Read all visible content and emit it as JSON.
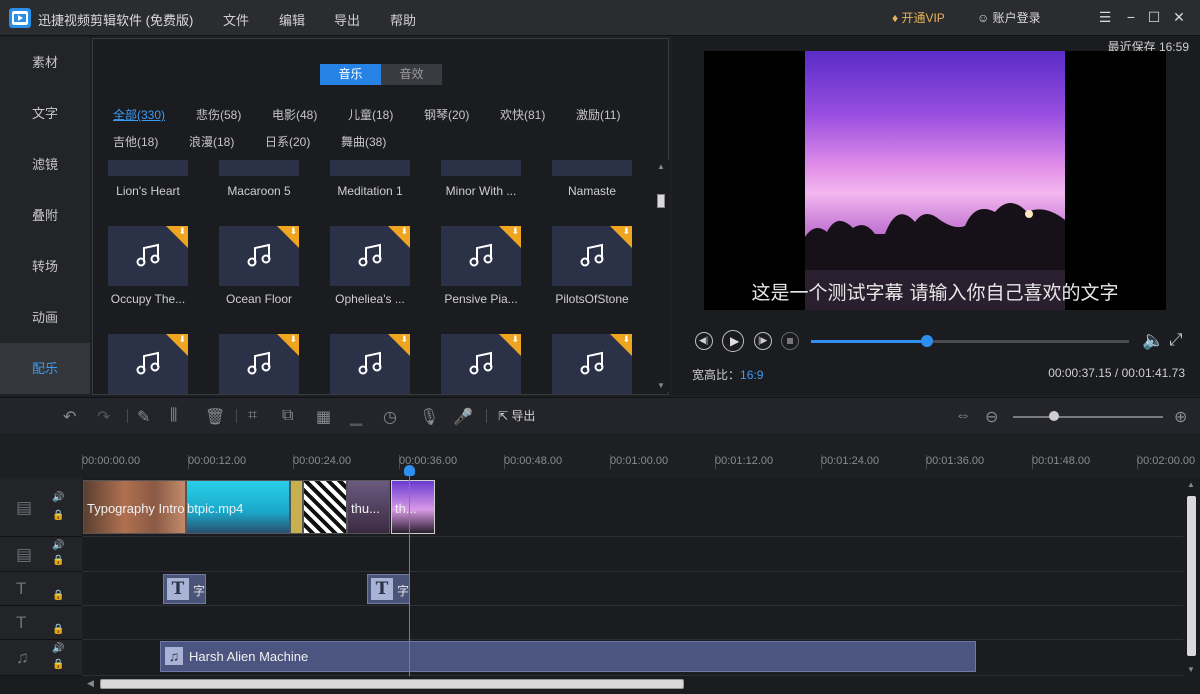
{
  "app": {
    "title": "迅捷视频剪辑软件 (免费版)",
    "accent": "#2e8ff0"
  },
  "menu": {
    "file": "文件",
    "edit": "编辑",
    "export": "导出",
    "help": "帮助"
  },
  "header": {
    "vip": "开通VIP",
    "account": "账户登录"
  },
  "sidebar": {
    "items": [
      {
        "label": "素材"
      },
      {
        "label": "文字"
      },
      {
        "label": "滤镜"
      },
      {
        "label": "叠附"
      },
      {
        "label": "转场"
      },
      {
        "label": "动画"
      },
      {
        "label": "配乐"
      }
    ]
  },
  "library": {
    "tabs": {
      "music": "音乐",
      "effects": "音效"
    },
    "categories": [
      "全部(330)",
      "悲伤(58)",
      "电影(48)",
      "儿童(18)",
      "钢琴(20)",
      "欢快(81)",
      "激励(11)",
      "吉他(18)",
      "浪漫(18)",
      "日系(20)",
      "舞曲(38)"
    ],
    "row0": [
      "Lion's Heart",
      "Macaroon 5",
      "Meditation 1",
      "Minor With ...",
      "Namaste"
    ],
    "row1": [
      "Occupy The...",
      "Ocean Floor",
      "Opheliea's ...",
      "Pensive Pia...",
      "PilotsOfStone"
    ]
  },
  "preview": {
    "saved": "最近保存 16:59",
    "subtitle": "这是一个测试字幕 请输入你自己喜欢的文字",
    "ratio_label": "宽高比：",
    "ratio_value": "16:9",
    "time": "00:00:37.15 / 00:01:41.73",
    "progress": 0.365
  },
  "toolbar": {
    "export": "导出",
    "zoom": 0.27
  },
  "ruler": [
    "00:00:00.00",
    "00:00:12.00",
    "00:00:24.00",
    "00:00:36.00",
    "00:00:48.00",
    "00:01:00.00",
    "00:01:12.00",
    "00:01:24.00",
    "00:01:36.00",
    "00:01:48.00",
    "00:02:00.00"
  ],
  "timeline": {
    "clips": [
      "Typography Intro",
      "btpic.mp4",
      "thu...",
      "th..."
    ],
    "text_clip": "字",
    "audio_clip": "Harsh Alien Machine"
  }
}
